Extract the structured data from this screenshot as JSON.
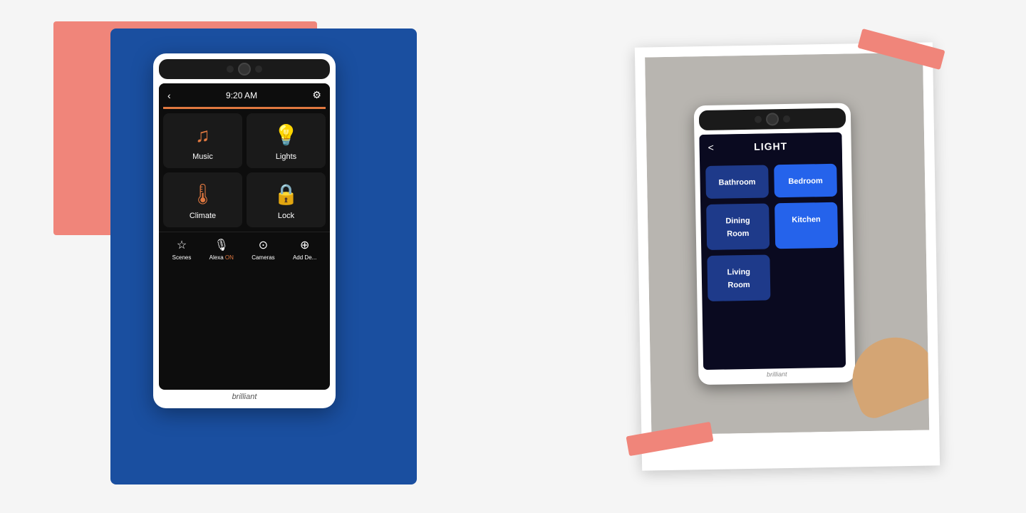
{
  "left": {
    "time": "9:20 AM",
    "tiles": [
      {
        "id": "music",
        "label": "Music",
        "icon": "♫"
      },
      {
        "id": "lights",
        "label": "Lights",
        "icon": "💡"
      },
      {
        "id": "climate",
        "label": "Climate",
        "icon": "🌡"
      },
      {
        "id": "lock",
        "label": "Lock",
        "icon": "🔒"
      }
    ],
    "nav": [
      {
        "id": "scenes",
        "label": "Scenes",
        "icon": "☆"
      },
      {
        "id": "alexa",
        "label": "Alexa ON",
        "icon": "🎙"
      },
      {
        "id": "cameras",
        "label": "Cameras",
        "icon": "⊙"
      },
      {
        "id": "add",
        "label": "Add De...",
        "icon": "+"
      }
    ],
    "brand": "brilliant"
  },
  "right": {
    "title": "LIGHT",
    "back_label": "<",
    "rooms": [
      {
        "label": "Bathroom",
        "active": false
      },
      {
        "label": "Bedroom",
        "active": true
      },
      {
        "label": "Dining\nRoom",
        "active": false
      },
      {
        "label": "Kitchen",
        "active": true
      },
      {
        "label": "Living\nRoom",
        "active": false
      }
    ],
    "brand": "brilliant"
  }
}
